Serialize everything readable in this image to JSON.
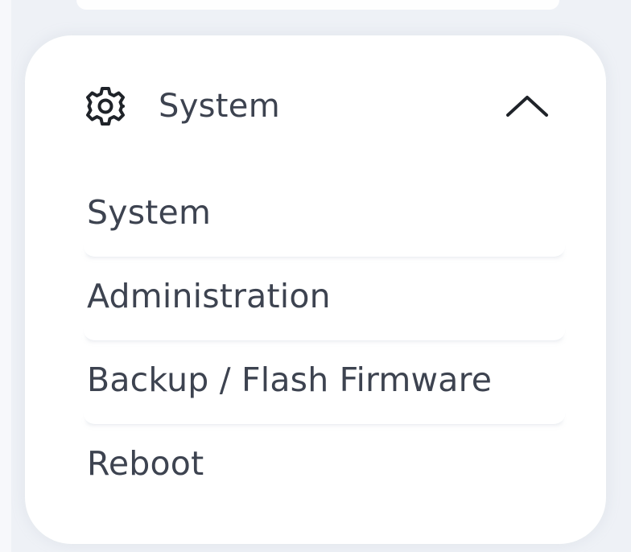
{
  "menu": {
    "header": {
      "label": "System",
      "icon": "gear-icon",
      "toggle_icon": "chevron-up-icon",
      "expanded": true
    },
    "items": [
      {
        "label": "System"
      },
      {
        "label": "Administration"
      },
      {
        "label": "Backup / Flash Firmware"
      },
      {
        "label": "Reboot"
      }
    ]
  },
  "colors": {
    "text": "#3d4350",
    "card_background": "#ffffff",
    "page_background": "#eef1f6"
  }
}
